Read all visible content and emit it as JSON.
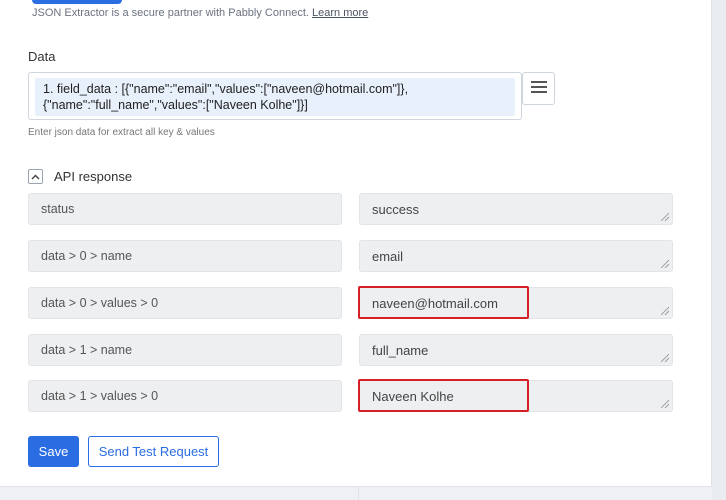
{
  "partner_note": {
    "text": "JSON Extractor is a secure partner with Pabbly Connect.",
    "link": "Learn more"
  },
  "data_section": {
    "label": "Data",
    "line1": "1. field_data : [{\"name\":\"email\",\"values\":[\"naveen@hotmail.com\"]},",
    "line2": "{\"name\":\"full_name\",\"values\":[\"Naveen Kolhe\"]}]",
    "hint": "Enter json data for extract all key & values"
  },
  "api_response": {
    "label": "API response",
    "rows": [
      {
        "key": "status",
        "value": "success",
        "highlighted": false
      },
      {
        "key": "data > 0 > name",
        "value": "email",
        "highlighted": false
      },
      {
        "key": "data > 0 > values > 0",
        "value": "naveen@hotmail.com",
        "highlighted": true
      },
      {
        "key": "data > 1 > name",
        "value": "full_name",
        "highlighted": false
      },
      {
        "key": "data > 1 > values > 0",
        "value": "Naveen Kolhe",
        "highlighted": true
      }
    ]
  },
  "buttons": {
    "save": "Save",
    "send_test": "Send Test Request"
  },
  "colors": {
    "primary": "#2a6de3",
    "highlight": "#d61f26"
  },
  "icons": [
    "hamburger-menu-icon",
    "chevron-up-icon",
    "resize-handle-icon"
  ]
}
